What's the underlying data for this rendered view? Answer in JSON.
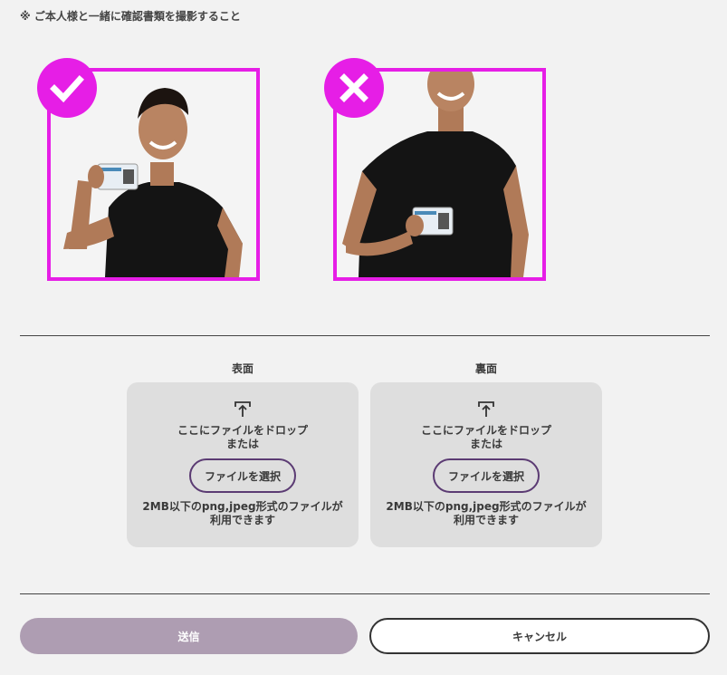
{
  "notice": "※ ご本人様と一緒に確認書類を撮影すること",
  "examples": {
    "good_icon": "check-icon",
    "bad_icon": "cross-icon",
    "accent_color": "#e61ee6"
  },
  "upload": {
    "front": {
      "label": "表面",
      "drop_line1": "ここにファイルをドロップ",
      "drop_line2": "または",
      "button": "ファイルを選択",
      "hint_line1": "2MB以下のpng,jpeg形式のファイルが",
      "hint_line2": "利用できます"
    },
    "back": {
      "label": "裏面",
      "drop_line1": "ここにファイルをドロップ",
      "drop_line2": "または",
      "button": "ファイルを選択",
      "hint_line1": "2MB以下のpng,jpeg形式のファイルが",
      "hint_line2": "利用できます"
    }
  },
  "actions": {
    "submit": "送信",
    "cancel": "キャンセル",
    "submit_color": "#ae9db2"
  }
}
